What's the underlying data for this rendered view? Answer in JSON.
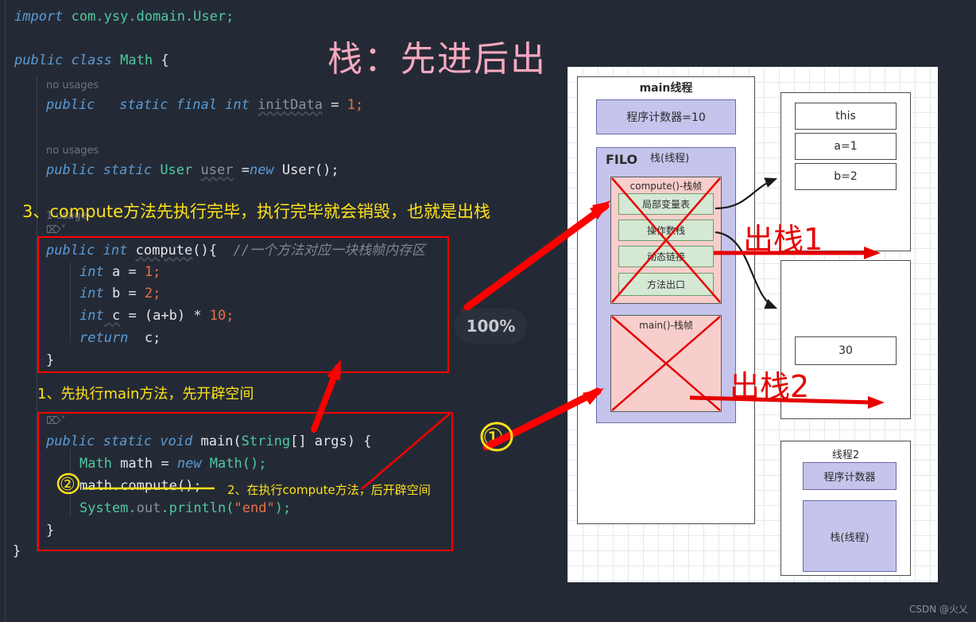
{
  "title": "栈：先进后出",
  "zoom_badge": "100%",
  "watermark": "CSDN @火乂",
  "editor": {
    "lines": {
      "import_kw": "import",
      "import_pkg": " com.ysy.domain.User;",
      "public": "public",
      "class": "class",
      "classname": "Math",
      "brace_open": "{",
      "no_usages": "no usages",
      "one_usage": "1 usage",
      "field1_mods": "public   static final int",
      "field1_name": "initData",
      "field1_eq": " = ",
      "field1_val": "1;",
      "field2_mods": "public static",
      "field2_type": "User",
      "field2_name": "user",
      "field2_eq": " =",
      "field2_new": "new",
      "field2_val": " User();",
      "compute_sig_kw": "public int",
      "compute_name": "compute",
      "compute_parens": "(){",
      "compute_comment": "//一个方法对应一块栈帧内存区",
      "a_decl": "int",
      "a_name": " a = ",
      "a_val": "1;",
      "b_decl": "int",
      "b_name": " b = ",
      "b_val": "2;",
      "c_decl": "int",
      "c_name": " c",
      "c_expr": " = (a+b) * ",
      "c_val": "10;",
      "return_kw": "return",
      "return_var": "  c;",
      "close_brace": "}",
      "main_mods": "public static void",
      "main_name": " main(",
      "main_param_type": "String",
      "main_param": "[] args) {",
      "math_type": "Math",
      "math_var": " math = ",
      "math_new": "new",
      "math_ctor": " Math();",
      "math_call_obj": "math.",
      "math_call_m": "compute",
      "math_call_rest": "();",
      "sysout_a": "System.",
      "sysout_b": "out",
      "sysout_c": ".println(",
      "sysout_str": "\"end\"",
      "sysout_d": ");",
      "class_close": "}"
    }
  },
  "annotations": {
    "note3": "3、compute方法先执行完毕，执行完毕就会销毁，也就是出栈",
    "note1": "1、先执行main方法，先开辟空间",
    "note2": "2、在执行compute方法，后开辟空间",
    "circle_marker_1": "①",
    "circle_marker_2": "②",
    "pop1": "出栈1",
    "pop2": "出栈2"
  },
  "diagram": {
    "main_thread_label": "main线程",
    "program_counter": "程序计数器=10",
    "filo": "FILO",
    "stack_thread": "栈(线程)",
    "compute_frame": "compute()-栈帧",
    "frame_parts": [
      "局部变量表",
      "操作数栈",
      "动态链接",
      "方法出口"
    ],
    "main_frame": "main()-栈帧",
    "local_vars": [
      "this",
      "a=1",
      "b=2"
    ],
    "operand_value": "30",
    "thread2_label": "线程2",
    "thread2_pc": "程序计数器",
    "thread2_stack": "栈(线程)"
  },
  "colors": {
    "editor_bg": "#242A35",
    "accent_red": "#FF0000",
    "accent_yellow": "#FFE11A",
    "title_pink": "#F5A8BE",
    "purple_fill": "#C5C4EC",
    "pink_fill": "#F8CECC",
    "green_fill": "#D5E8D4"
  }
}
